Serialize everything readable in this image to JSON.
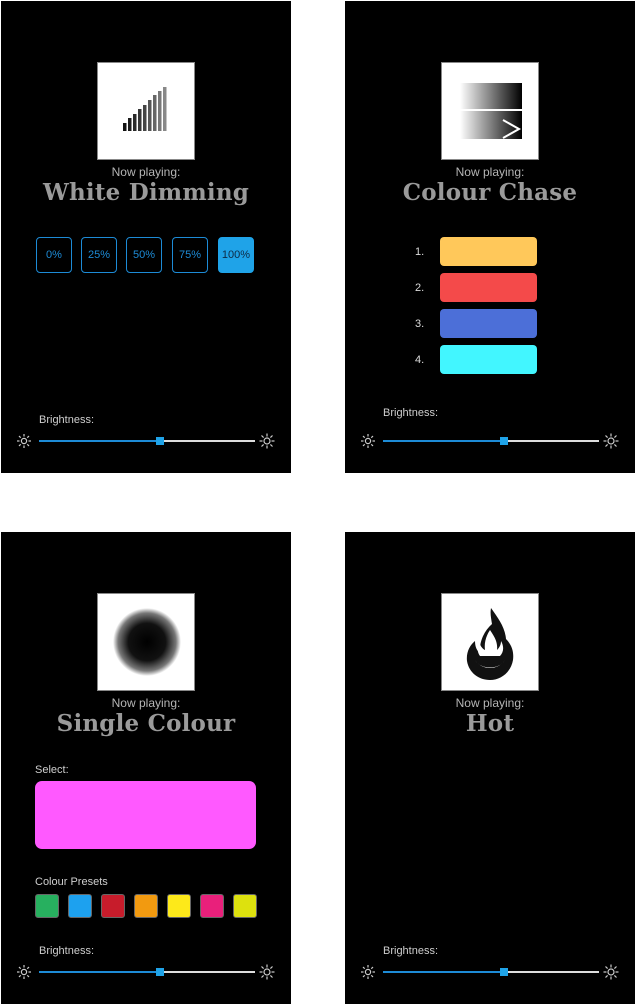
{
  "now_playing_label": "Now playing:",
  "brightness_label": "Brightness:",
  "panel1": {
    "title": "White Dimming",
    "presets": [
      {
        "label": "0%",
        "active": false
      },
      {
        "label": "25%",
        "active": false
      },
      {
        "label": "50%",
        "active": false
      },
      {
        "label": "75%",
        "active": false
      },
      {
        "label": "100%",
        "active": true
      }
    ],
    "brightness": 0.56
  },
  "panel2": {
    "title": "Colour Chase",
    "colours": [
      {
        "num": "1.",
        "color": "#ffc85a"
      },
      {
        "num": "2.",
        "color": "#f44a4a"
      },
      {
        "num": "3.",
        "color": "#4c6fd8"
      },
      {
        "num": "4.",
        "color": "#42f6ff"
      }
    ],
    "brightness": 0.56
  },
  "panel3": {
    "title": "Single Colour",
    "select_label": "Select:",
    "selected_color": "#ff59ff",
    "presets_label": "Colour Presets",
    "preset_colors": [
      "#27b05f",
      "#1da1ef",
      "#c71c2b",
      "#f29a10",
      "#fde91a",
      "#e9207b",
      "#dde10e"
    ],
    "brightness": 0.56
  },
  "panel4": {
    "title": "Hot",
    "brightness": 0.56
  },
  "icons": {
    "panel1": "signal-bars-icon",
    "panel2": "gradient-chase-icon",
    "panel3": "blurred-dot-icon",
    "panel4": "flame-icon",
    "brightness_min": "sun-small-icon",
    "brightness_max": "sun-large-icon"
  },
  "colors": {
    "accent": "#1d8bd6",
    "panel_bg": "#000000",
    "title_text": "#9a9a9a"
  }
}
